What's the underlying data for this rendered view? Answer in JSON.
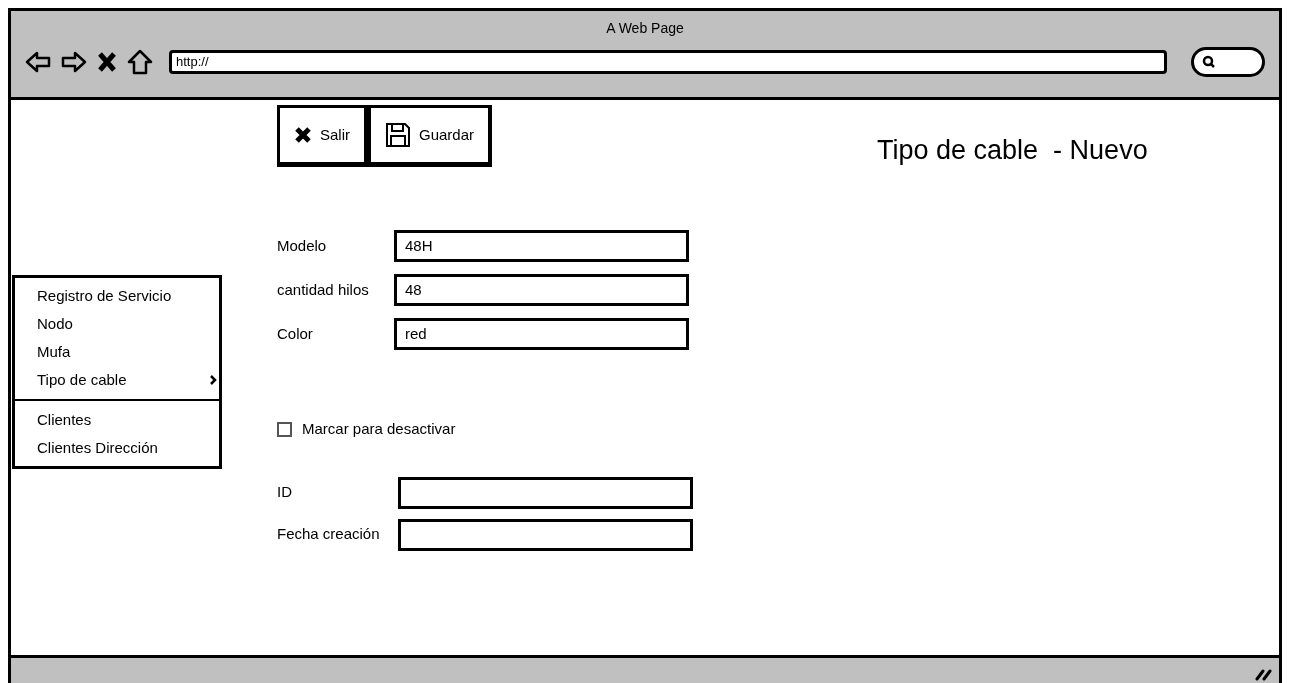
{
  "window": {
    "title": "A Web Page"
  },
  "address_bar": {
    "value": "http://"
  },
  "toolbar": [
    {
      "kind": "exit",
      "label": "Salir"
    },
    {
      "kind": "save",
      "label": "Guardar"
    }
  ],
  "page_title": "Tipo de cable  - Nuevo",
  "menu": [
    {
      "kind": "item",
      "label": "Registro de Servicio",
      "submenu": false
    },
    {
      "kind": "item",
      "label": "Nodo",
      "submenu": false
    },
    {
      "kind": "item",
      "label": "Mufa",
      "submenu": false
    },
    {
      "kind": "item",
      "label": "Tipo de cable",
      "submenu": true
    },
    {
      "kind": "separator"
    },
    {
      "kind": "item",
      "label": "Clientes",
      "submenu": false
    },
    {
      "kind": "item",
      "label": "Clientes Dirección",
      "submenu": false
    }
  ],
  "fields": [
    {
      "label": "Modelo",
      "value": "48H"
    },
    {
      "label": "cantidad hilos",
      "value": "48"
    },
    {
      "label": "Color",
      "value": "red"
    }
  ],
  "deactivate": {
    "label": "Marcar para desactivar",
    "checked": false
  },
  "meta_fields": [
    {
      "label": "ID"
    },
    {
      "label": "Fecha creación"
    }
  ]
}
